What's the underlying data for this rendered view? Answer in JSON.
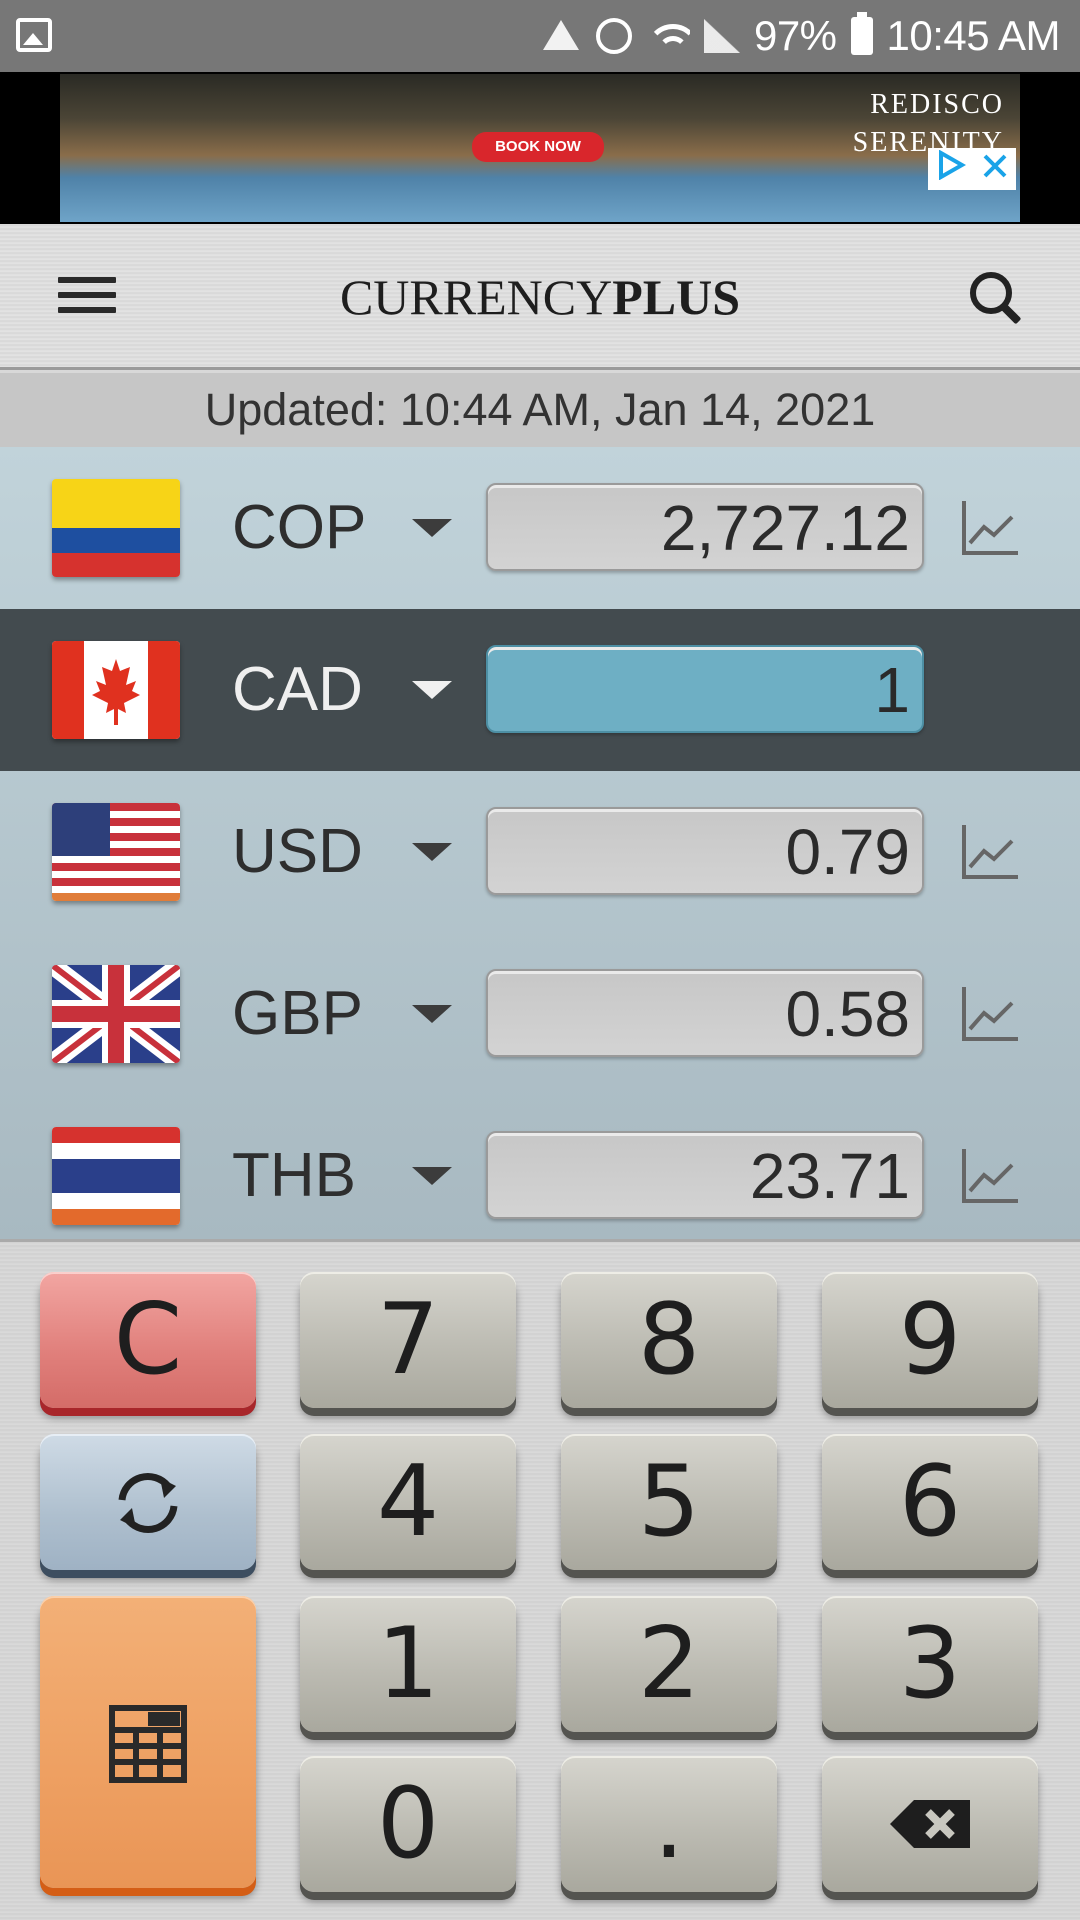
{
  "status_bar": {
    "battery": "97%",
    "time": "10:45 AM",
    "icons": [
      "gallery-icon",
      "recycle-icon",
      "alarm-icon",
      "wifi-icon",
      "signal-icon",
      "battery-icon"
    ]
  },
  "ad": {
    "cta": "BOOK NOW",
    "headline_line1": "REDISCO",
    "headline_line2": "SERENITY",
    "icons": [
      "adchoices-icon",
      "close-icon"
    ]
  },
  "header": {
    "logo_regular": "CURRENCY",
    "logo_bold": "PLUS",
    "icons": [
      "menu-icon",
      "search-icon"
    ]
  },
  "updated_text": "Updated: 10:44 AM, Jan 14, 2021",
  "currencies": [
    {
      "code": "COP",
      "value": "2,727.12",
      "active": false,
      "flag": "colombia-flag"
    },
    {
      "code": "CAD",
      "value": "1",
      "active": true,
      "flag": "canada-flag"
    },
    {
      "code": "USD",
      "value": "0.79",
      "active": false,
      "flag": "usa-flag"
    },
    {
      "code": "GBP",
      "value": "0.58",
      "active": false,
      "flag": "uk-flag"
    },
    {
      "code": "THB",
      "value": "23.71",
      "active": false,
      "flag": "thailand-flag"
    }
  ],
  "keypad": {
    "clear": "C",
    "digits": {
      "d7": "7",
      "d8": "8",
      "d9": "9",
      "d4": "4",
      "d5": "5",
      "d6": "6",
      "d1": "1",
      "d2": "2",
      "d3": "3",
      "d0": "0"
    },
    "decimal": ".",
    "icons": [
      "refresh-icon",
      "calculator-icon",
      "backspace-icon"
    ]
  },
  "colors": {
    "active_row": "#434b4f",
    "active_input": "#6eafc4",
    "clear_key": "#e07f7b",
    "refresh_key": "#aebfce",
    "calc_key": "#eea062"
  }
}
